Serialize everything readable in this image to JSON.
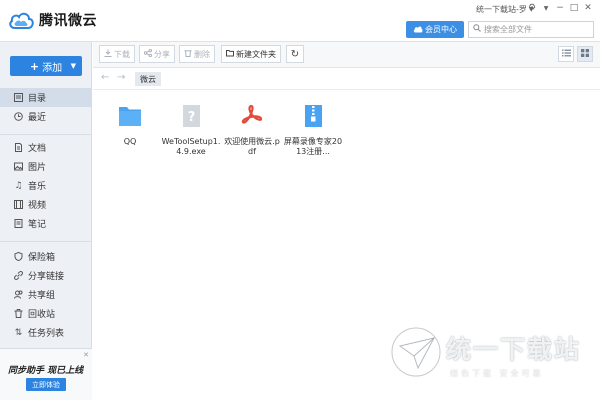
{
  "app": {
    "title": "腾讯微云"
  },
  "header": {
    "user_label": "统一下载站-罗",
    "vip_label": "会员中心",
    "search_placeholder": "搜索全部文件"
  },
  "sidebar": {
    "add_label": "添加",
    "items": [
      {
        "label": "目录",
        "icon": "directory-icon",
        "active": true
      },
      {
        "label": "最近",
        "icon": "clock-icon"
      },
      {
        "label": "文档",
        "icon": "document-icon"
      },
      {
        "label": "图片",
        "icon": "image-icon"
      },
      {
        "label": "音乐",
        "icon": "music-icon"
      },
      {
        "label": "视频",
        "icon": "video-icon"
      },
      {
        "label": "笔记",
        "icon": "note-icon"
      },
      {
        "label": "保险箱",
        "icon": "shield-icon"
      },
      {
        "label": "分享链接",
        "icon": "link-icon"
      },
      {
        "label": "共享组",
        "icon": "group-icon"
      },
      {
        "label": "回收站",
        "icon": "trash-icon"
      },
      {
        "label": "任务列表",
        "icon": "transfer-icon"
      }
    ],
    "promo": {
      "title": "同步助手 现已上线",
      "button": "立即体验"
    }
  },
  "toolbar": {
    "download": "下载",
    "share": "分享",
    "delete": "删除",
    "new_folder": "新建文件夹"
  },
  "path": {
    "current": "微云"
  },
  "files": [
    {
      "name": "QQ",
      "type": "folder"
    },
    {
      "name": "WeToolSetup1.4.9.exe",
      "type": "exe"
    },
    {
      "name": "欢迎使用微云.pdf",
      "type": "pdf"
    },
    {
      "name": "屏幕录像专家2013注册...",
      "type": "zip"
    }
  ],
  "watermark": {
    "title": "统一下载站",
    "subtitle": "绿色下载  安全可靠"
  },
  "colors": {
    "accent": "#2d84e0",
    "sidebar_bg": "#edf1f6",
    "folder": "#4aa3f0",
    "pdf": "#e24b3b"
  }
}
